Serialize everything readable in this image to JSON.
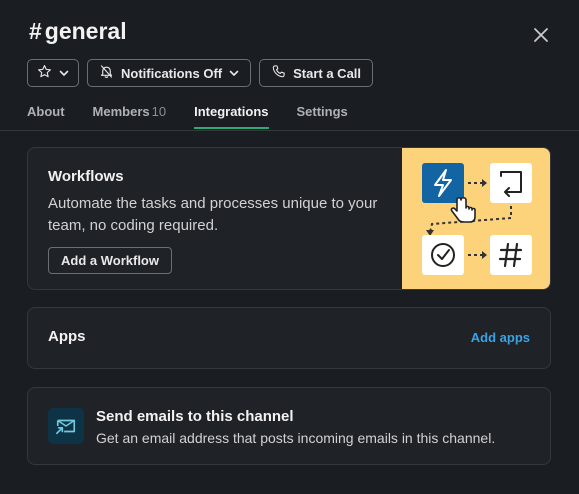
{
  "header": {
    "hash": "#",
    "channel_name": "general"
  },
  "controls": {
    "star_icon": "star-icon",
    "notifications_label": "Notifications Off",
    "call_label": "Start a Call"
  },
  "tabs": [
    {
      "label": "About"
    },
    {
      "label": "Members",
      "count": "10"
    },
    {
      "label": "Integrations",
      "active": true
    },
    {
      "label": "Settings"
    }
  ],
  "workflows": {
    "title": "Workflows",
    "description": "Automate the tasks and processes unique to your team, no coding required.",
    "button_label": "Add a Workflow"
  },
  "apps": {
    "title": "Apps",
    "link_label": "Add apps"
  },
  "email": {
    "title": "Send emails to this channel",
    "description": "Get an email address that posts incoming emails in this channel."
  },
  "colors": {
    "background": "#1a1d21",
    "card": "#1f2226",
    "accent_green": "#2bac76",
    "link_blue": "#3aa3e3",
    "illustration_bg": "#fcd37a"
  }
}
